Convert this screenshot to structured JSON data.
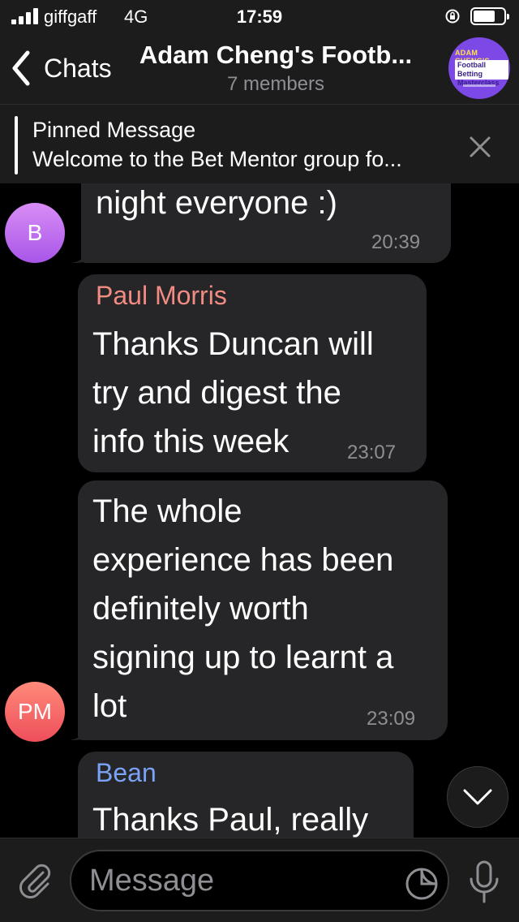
{
  "status_bar": {
    "carrier": "giffgaff",
    "network": "4G",
    "time": "17:59",
    "icons": [
      "signal-icon",
      "rotation-lock-icon",
      "battery-icon"
    ]
  },
  "header": {
    "back_label": "Chats",
    "title": "Adam Cheng's Footb...",
    "subtitle": "7 members",
    "avatar": {
      "top_text": "ADAM CHENG'S",
      "box_text": "Football Betting Masterclass"
    }
  },
  "pinned": {
    "title": "Pinned Message",
    "text": "Welcome to the Bet Mentor group fo..."
  },
  "messages": [
    {
      "avatar_initials": "B",
      "text": "night everyone :)",
      "time": "20:39"
    },
    {
      "sender": "Paul Morris",
      "text": "Thanks Duncan will try and digest the info this week",
      "lines": [
        "Thanks Duncan will",
        "try and digest the",
        "info this week"
      ],
      "time": "23:07"
    },
    {
      "avatar_initials": "PM",
      "text": "The whole experience has been definitely worth signing up to learnt a lot",
      "lines": [
        "The whole",
        "experience has been",
        "definitely worth",
        "signing up to learnt a",
        "lot"
      ],
      "time": "23:09"
    },
    {
      "sender": "Bean",
      "text": "Thanks Paul, really"
    }
  ],
  "input": {
    "placeholder": "Message"
  },
  "colors": {
    "bar_bg": "#1c1c1d",
    "bubble_bg": "#262628",
    "sender_paul": "#f28b82",
    "sender_bean": "#7aa2f7",
    "muted": "#8e8e93"
  }
}
